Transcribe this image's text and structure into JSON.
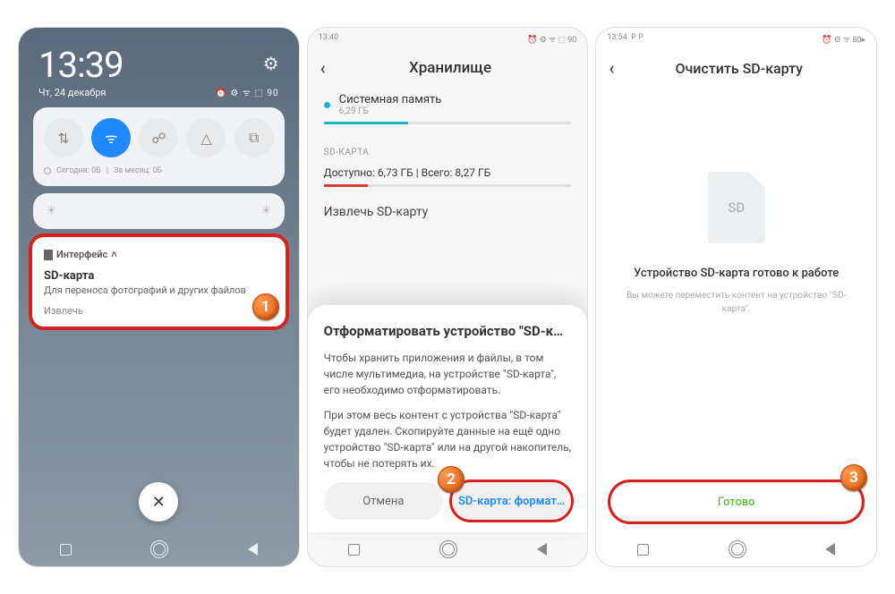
{
  "screen1": {
    "time": "13:39",
    "date": "Чт, 24 декабря",
    "status_icons": "⏰ ⚙ ᯤ ⬚ 90",
    "quick": {
      "data_today": "Сегодня: 0Б",
      "data_month": "За месяц: 0Б"
    },
    "notif": {
      "app": "Интерфейс",
      "title": "SD-карта",
      "body": "Для переноса фотографий и других файлов",
      "action": "Извлечь"
    },
    "badge": "1"
  },
  "screen2": {
    "status_time": "13:40",
    "status_icons": "⏰ ⚙ ᯤ ⬚ 90",
    "header": "Хранилище",
    "sys_label": "Системная память",
    "sys_size": "6,29 ГБ",
    "sd_section": "SD-КАРТА",
    "sd_avail": "Доступно: 6,73 ГБ | Всего: 8,27 ГБ",
    "sd_eject": "Извлечь SD-карту",
    "sheet": {
      "title": "Отформатировать устройство \"SD-к…",
      "p1": "Чтобы хранить приложения и файлы, в том числе мультимедиа, на устройстве \"SD-карта\", его необходимо отформатировать.",
      "p2": "При этом весь контент с устройства \"SD-карта\" будет удален. Скопируйте данные на ещё одно устройство \"SD-карта\" или на другой накопитель, чтобы не потерять их.",
      "cancel": "Отмена",
      "format": "SD-карта: формат…"
    },
    "badge": "2"
  },
  "screen3": {
    "status_time": "13:54",
    "status_extra": "P P",
    "status_icons": "⏰ ⚙ ᯤ 80▸",
    "header": "Очистить SD-карту",
    "sd_label": "SD",
    "ready": "Устройство SD-карта готово к работе",
    "hint": "Вы можете переместить контент на устройство \"SD-карта\".",
    "done": "Готово",
    "badge": "3"
  }
}
